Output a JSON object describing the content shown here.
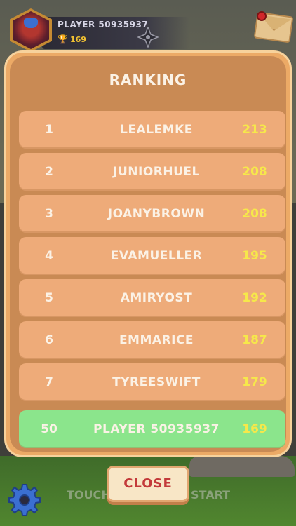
{
  "player": {
    "name": "PLAYER 50935937",
    "trophies": "169"
  },
  "panel": {
    "title": "RANKING"
  },
  "rankings": [
    {
      "rank": "1",
      "name": "LEALEMKE",
      "score": "213"
    },
    {
      "rank": "2",
      "name": "JUNIORHUEL",
      "score": "208"
    },
    {
      "rank": "3",
      "name": "JOANYBROWN",
      "score": "208"
    },
    {
      "rank": "4",
      "name": "EVAMUELLER",
      "score": "195"
    },
    {
      "rank": "5",
      "name": "AMIRYOST",
      "score": "192"
    },
    {
      "rank": "6",
      "name": "EMMARICE",
      "score": "187"
    },
    {
      "rank": "7",
      "name": "TYREESWIFT",
      "score": "179"
    }
  ],
  "current_player_row": {
    "rank": "50",
    "name": "PLAYER 50935937",
    "score": "169"
  },
  "bottom": {
    "close_label": "CLOSE",
    "touch_text": "TOUCH",
    "start_text": "START"
  },
  "icons": {
    "avatar": "warrior-avatar",
    "trophy": "trophy-icon",
    "shuriken": "shuriken-icon",
    "mail": "mail-icon",
    "settings": "gear-icon"
  },
  "colors": {
    "score": "#f6e84a",
    "highlight_row": "#8be58c",
    "close_text": "#c33a3a"
  }
}
